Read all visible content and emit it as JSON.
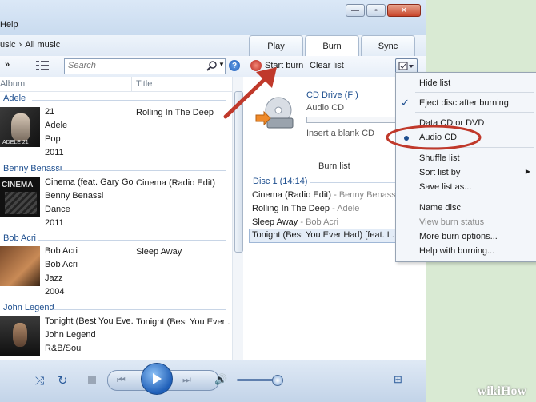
{
  "window": {
    "menu_help": "Help",
    "breadcrumb": [
      "usic",
      "›",
      "All music"
    ]
  },
  "tabs": [
    "Play",
    "Burn",
    "Sync"
  ],
  "toolbar": {
    "chevrons": "»",
    "search_placeholder": "Search",
    "help": "?",
    "start_burn": "Start burn",
    "clear_list": "Clear list"
  },
  "columns": {
    "album": "Album",
    "title": "Title"
  },
  "library": [
    {
      "artist": "Adele",
      "album": "21",
      "album_artist": "Adele",
      "genre": "Pop",
      "year": "2011",
      "track": "Rolling In The Deep",
      "art_text": "ADELE 21",
      "art_icon": "album-art-adele"
    },
    {
      "artist": "Benny Benassi",
      "album": "Cinema (feat. Gary Go...",
      "album_artist": "Benny Benassi",
      "genre": "Dance",
      "year": "2011",
      "track": "Cinema (Radio Edit)",
      "art_text": "CINEMA",
      "art_icon": "album-art-benassi"
    },
    {
      "artist": "Bob Acri",
      "album": "Bob Acri",
      "album_artist": "Bob Acri",
      "genre": "Jazz",
      "year": "2004",
      "track": "Sleep Away",
      "art_text": "",
      "art_icon": "album-art-bob-acri"
    },
    {
      "artist": "John Legend",
      "album": "Tonight (Best You Eve...",
      "album_artist": "John Legend",
      "genre": "R&B/Soul",
      "year": "",
      "track": "Tonight (Best You Ever ...",
      "art_text": "",
      "art_icon": "album-art-john-legend"
    }
  ],
  "burn": {
    "drive": "CD Drive (F:)",
    "disc_type": "Audio CD",
    "insert_msg": "Insert a blank CD",
    "list_title": "Burn list",
    "disc_label": "Disc 1 (14:14)",
    "items": [
      {
        "title": "Cinema (Radio Edit)",
        "sep": " - ",
        "artist": "Benny Benassi"
      },
      {
        "title": "Rolling In The Deep",
        "sep": " - ",
        "artist": "Adele"
      },
      {
        "title": "Sleep Away",
        "sep": " - ",
        "artist": "Bob Acri"
      },
      {
        "title": "Tonight (Best You Ever Had) [feat. L...",
        "sep": "",
        "artist": ""
      }
    ]
  },
  "menu": {
    "hide_list": "Hide list",
    "eject": "Eject disc after burning",
    "data_cd": "Data CD or DVD",
    "audio_cd": "Audio CD",
    "shuffle": "Shuffle list",
    "sort": "Sort list by",
    "save": "Save list as...",
    "name_disc": "Name disc",
    "view_status": "View burn status",
    "more_options": "More burn options...",
    "help": "Help with burning..."
  },
  "watermark": "wikiHow",
  "colors": {
    "highlight": "#c0392b",
    "accent": "#1e4f8f"
  }
}
